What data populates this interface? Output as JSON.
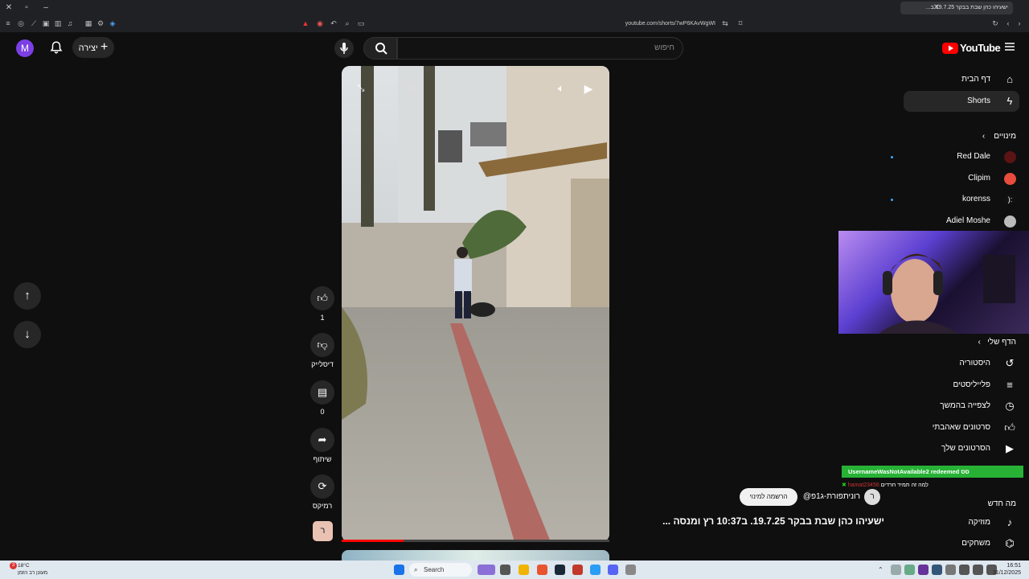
{
  "browser": {
    "tab_title": "ישעיהו כהן שבת בבקר 19.7.25 ב...",
    "url": "youtube.com/shorts/7wP6KAvWgWI"
  },
  "header": {
    "avatar_letter": "M",
    "create_label": "יצירה",
    "search_placeholder": "חיפוש",
    "logo_text": "YouTube"
  },
  "sidebar": {
    "home": "דף הבית",
    "shorts": "Shorts",
    "subscriptions": "מינויים",
    "channels": [
      {
        "name": "Red Dale",
        "color": "#b22",
        "dot": true
      },
      {
        "name": "Clipim",
        "color": "#e74c3c",
        "dot": false
      },
      {
        "name": "korenss",
        "color": "#333",
        "dot": true
      },
      {
        "name": "Adiel Moshe",
        "color": "#bbb",
        "dot": false
      }
    ],
    "you": "הדף שלי",
    "history": "היסטוריה",
    "playlists": "פלייליסטים",
    "watch_later": "לצפייה בהמשך",
    "liked": "סרטונים שאהבתי",
    "your_videos": "הסרטונים שלך",
    "explore": "מה חדש",
    "music": "מוזיקה",
    "gaming": "משחקים"
  },
  "short": {
    "likes": "1",
    "dislike_label": "דיסלייק",
    "comments": "0",
    "share_label": "שיתוף",
    "remix_label": "רמיקס",
    "channel_avatar_letter": "ר",
    "subscribe_label": "הרשמה למינוי",
    "channel_name": "@רונית​פורת-ג1פ",
    "title": "ישעיהו כהן שבת בבקר 19.7.25. ב10:37 רץ ומנסה ...",
    "progress": 0.23
  },
  "stream_overlay": {
    "alert": "UsernameWasNotAvailable2 redeemed סס",
    "chat_user": "hamat23456",
    "chat_text": "למה זה תמיד חרדים"
  },
  "taskbar": {
    "weather_temp": "18°C",
    "weather_desc": "מעונן רב הזמן",
    "search": "Search",
    "time": "16:51",
    "date": "31/12/2025",
    "notif_count": "3"
  }
}
